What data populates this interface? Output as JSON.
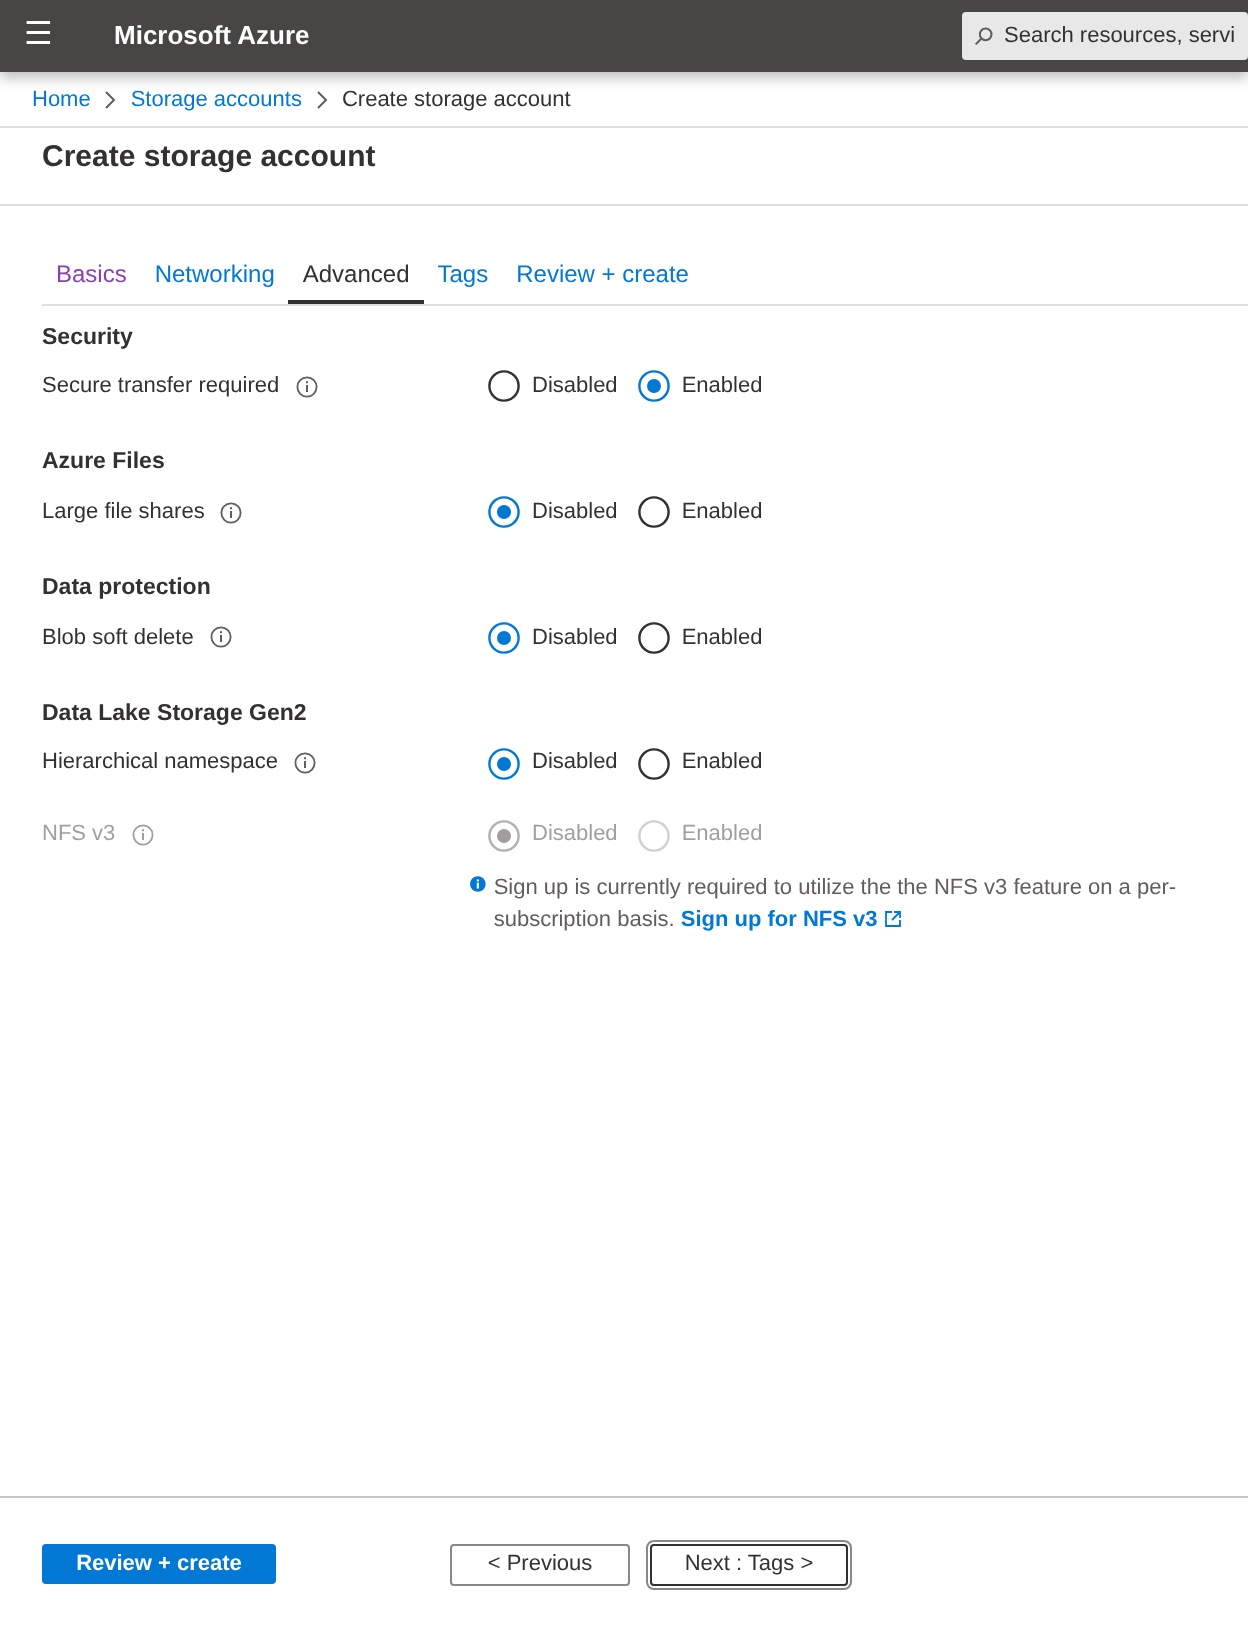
{
  "topbar": {
    "menu_icon": "☰",
    "brand": "Microsoft Azure",
    "search": {
      "placeholder": "Search resources, servi"
    }
  },
  "breadcrumb": [
    "Home",
    "Storage accounts",
    "Create storage account"
  ],
  "title": "Create storage account",
  "tabs": [
    {
      "label": "Basics",
      "selected": false,
      "visited": true
    },
    {
      "label": "Networking",
      "selected": false,
      "visited": false
    },
    {
      "label": "Advanced",
      "selected": true,
      "visited": false
    },
    {
      "label": "Tags",
      "selected": false,
      "visited": false
    },
    {
      "label": "Review + create",
      "selected": false,
      "visited": false
    }
  ],
  "sections": [
    {
      "heading": "Security",
      "fields": [
        {
          "label": "Secure transfer required",
          "disabled": false,
          "options": [
            {
              "label": "Disabled",
              "selected": false
            },
            {
              "label": "Enabled",
              "selected": true
            }
          ]
        }
      ]
    },
    {
      "heading": "Azure Files",
      "fields": [
        {
          "label": "Large file shares",
          "disabled": false,
          "options": [
            {
              "label": "Disabled",
              "selected": true
            },
            {
              "label": "Enabled",
              "selected": false
            }
          ]
        }
      ]
    },
    {
      "heading": "Data protection",
      "fields": [
        {
          "label": "Blob soft delete",
          "disabled": false,
          "options": [
            {
              "label": "Disabled",
              "selected": true
            },
            {
              "label": "Enabled",
              "selected": false
            }
          ]
        }
      ]
    },
    {
      "heading": "Data Lake Storage Gen2",
      "fields": [
        {
          "label": "Hierarchical namespace",
          "disabled": false,
          "options": [
            {
              "label": "Disabled",
              "selected": true
            },
            {
              "label": "Enabled",
              "selected": false
            }
          ]
        },
        {
          "label": "NFS v3",
          "disabled": true,
          "options": [
            {
              "label": "Disabled",
              "selected": true
            },
            {
              "label": "Enabled",
              "selected": false
            }
          ],
          "note": {
            "text": "Sign up is currently required to utilize the the NFS v3 feature on a per-subscription basis.",
            "link": "Sign up for NFS v3"
          }
        }
      ]
    }
  ],
  "footer": {
    "primary": "Review + create",
    "previous": "< Previous",
    "next": "Next : Tags >"
  }
}
